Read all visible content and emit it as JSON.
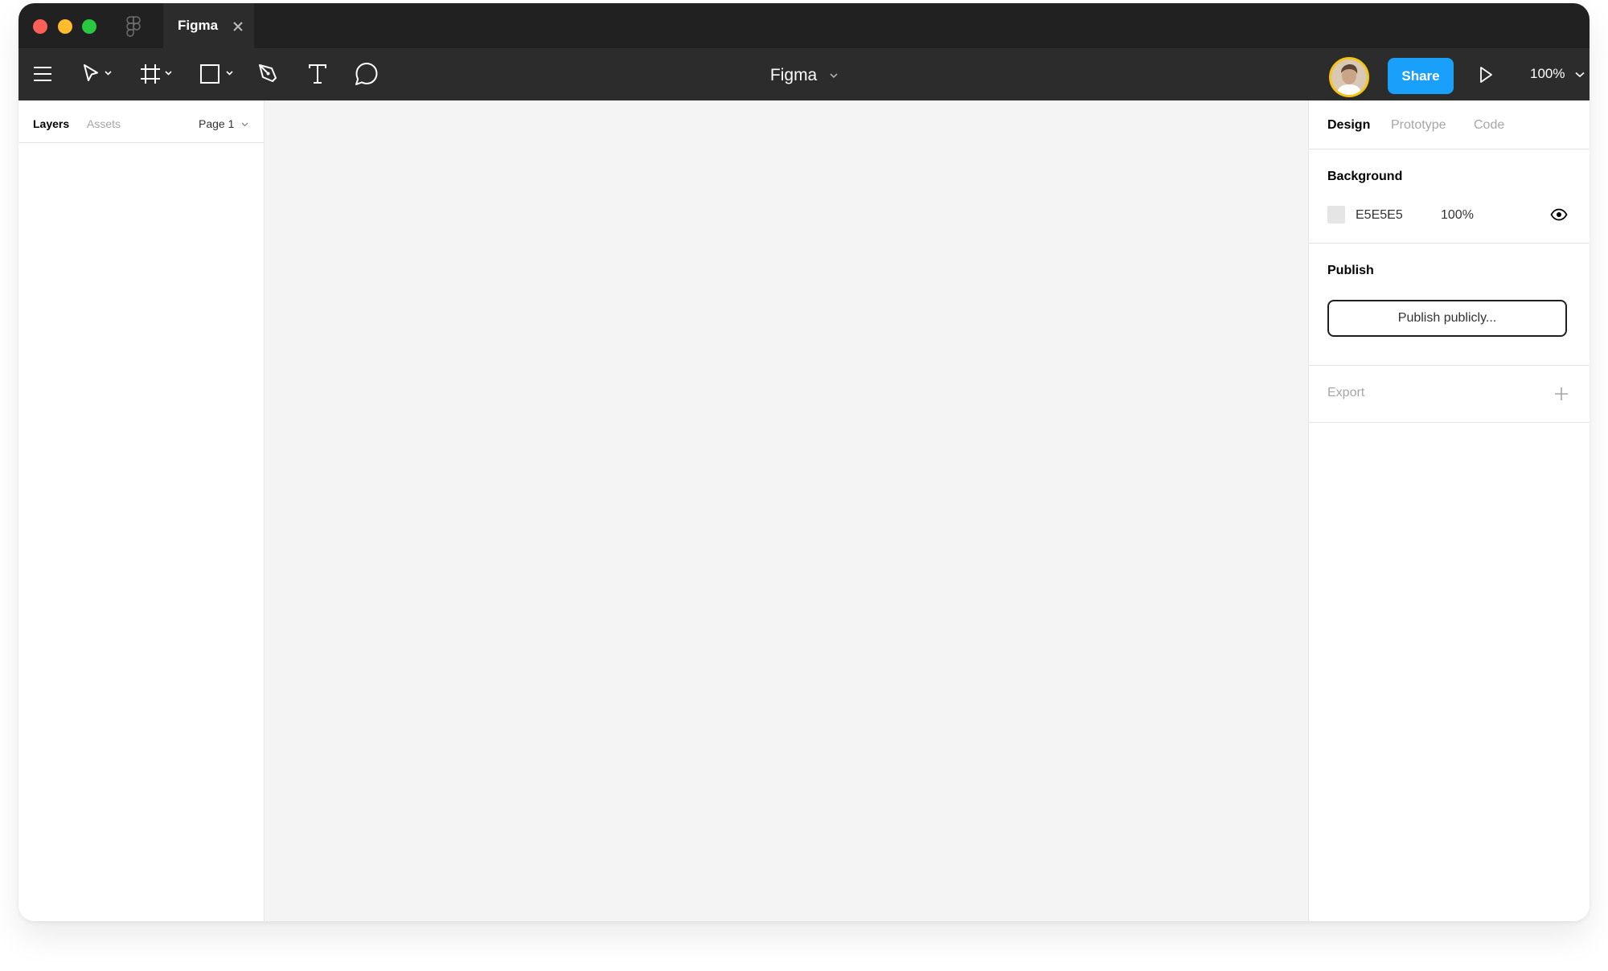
{
  "titlebar": {
    "tab_title": "Figma"
  },
  "toolbar": {
    "file_title": "Figma",
    "share_label": "Share",
    "zoom_label": "100%",
    "avatar_ring_color": "#f5c518",
    "share_color": "#18a0fb"
  },
  "left_panel": {
    "tabs": [
      "Layers",
      "Assets"
    ],
    "page_label": "Page 1"
  },
  "right_panel": {
    "tabs": [
      "Design",
      "Prototype",
      "Code"
    ],
    "background": {
      "title": "Background",
      "hex": "E5E5E5",
      "opacity": "100%",
      "swatch_color": "#e5e5e5"
    },
    "publish": {
      "title": "Publish",
      "button_label": "Publish publicly..."
    },
    "export": {
      "title": "Export"
    }
  },
  "icons": [
    "figma-logo-icon",
    "close-icon",
    "menu-icon",
    "move-tool-icon",
    "frame-tool-icon",
    "rectangle-tool-icon",
    "pen-tool-icon",
    "text-tool-icon",
    "comment-tool-icon",
    "chevron-down-icon",
    "play-icon",
    "eye-icon",
    "plus-icon"
  ]
}
